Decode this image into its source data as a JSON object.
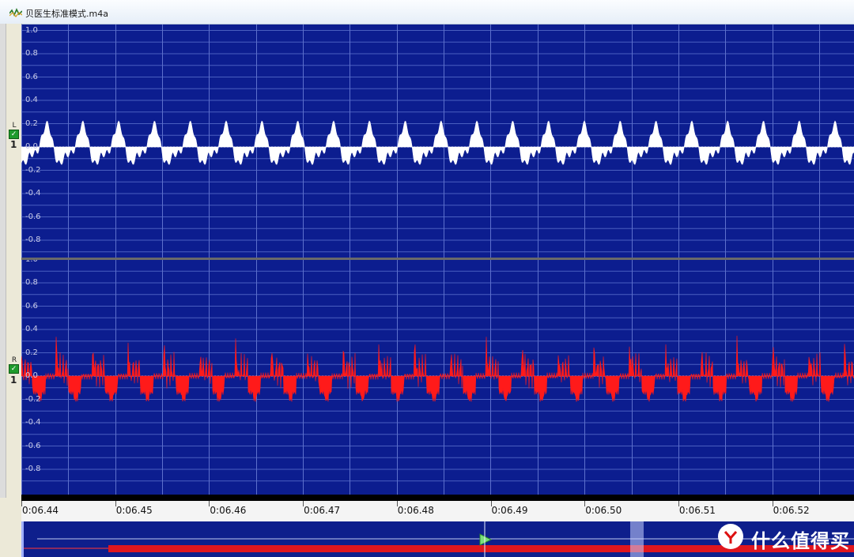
{
  "window": {
    "title": "贝医生标准模式.m4a"
  },
  "channels": [
    {
      "id": "L",
      "label": "L",
      "checked": true,
      "track_number": "1",
      "wave_color": "#ffffff",
      "y_ticks": [
        "1.0",
        "0.8",
        "0.6",
        "0.4",
        "0.2",
        "0.0",
        "-0.2",
        "-0.4",
        "-0.6",
        "-0.8"
      ]
    },
    {
      "id": "R",
      "label": "R",
      "checked": true,
      "track_number": "1",
      "wave_color": "#ff1a1a",
      "y_ticks": [
        "1.0",
        "0.8",
        "0.6",
        "0.4",
        "0.2",
        "0.0",
        "-0.2",
        "-0.4",
        "-0.6",
        "-0.8"
      ]
    }
  ],
  "timeline": {
    "labels": [
      "0:06.44",
      "0:06.45",
      "0:06.46",
      "0:06.47",
      "0:06.48",
      "0:06.49",
      "0:06.50",
      "0:06.51",
      "0:06.52"
    ]
  },
  "watermark": {
    "text": "什么值得买"
  },
  "colors": {
    "background": "#0c1d8f",
    "grid": "#4a5fc0",
    "left_wave": "#ffffff",
    "right_wave": "#ff1a1a",
    "overview_wave": "#e0161e"
  }
}
